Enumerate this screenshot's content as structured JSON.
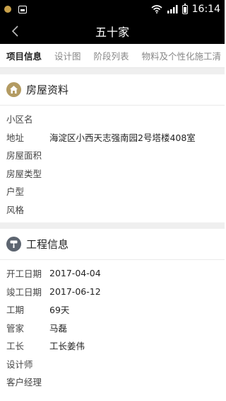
{
  "status": {
    "time": "16:14"
  },
  "header": {
    "title": "五十家"
  },
  "tabs": [
    "项目信息",
    "设计图",
    "阶段列表",
    "物料及个性化施工清"
  ],
  "house": {
    "title": "房屋资料",
    "rows": [
      {
        "label": "小区名",
        "value": ""
      },
      {
        "label": "地址",
        "value": "海淀区小西天志强南园2号塔楼408室"
      },
      {
        "label": "房屋面积",
        "value": ""
      },
      {
        "label": "房屋类型",
        "value": ""
      },
      {
        "label": "户型",
        "value": ""
      },
      {
        "label": "风格",
        "value": ""
      }
    ]
  },
  "project": {
    "title": "工程信息",
    "rows": [
      {
        "label": "开工日期",
        "value": "2017-04-04"
      },
      {
        "label": "竣工日期",
        "value": "2017-06-12"
      },
      {
        "label": "工期",
        "value": "69天"
      },
      {
        "label": "管家",
        "value": "马磊"
      },
      {
        "label": "工长",
        "value": "工长姜伟"
      },
      {
        "label": "设计师",
        "value": ""
      },
      {
        "label": "客户经理",
        "value": ""
      }
    ]
  },
  "colors": {
    "house_icon": "#b39b62",
    "project_icon": "#5d6570"
  },
  "icons": [
    "notification-dot-icon",
    "gallery-icon",
    "wifi-icon",
    "signal-icon",
    "battery-icon",
    "back-chevron-icon",
    "house-icon",
    "roller-brush-icon"
  ]
}
